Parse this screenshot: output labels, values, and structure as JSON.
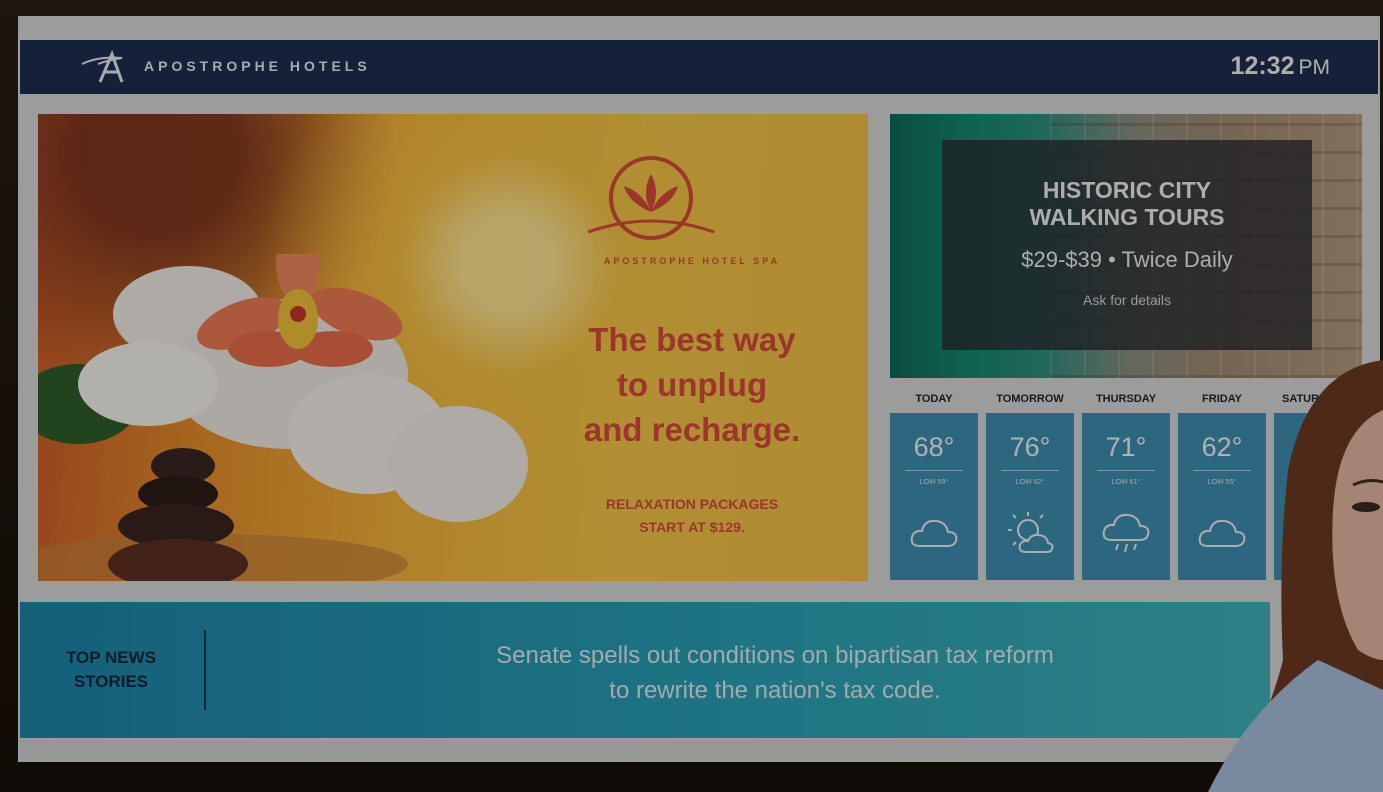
{
  "header": {
    "brand": "APOSTROPHE HOTELS",
    "time": "12:32",
    "ampm": "PM",
    "logo_icon": "apostrophe-a-logo-icon"
  },
  "spa_ad": {
    "spa_name": "APOSTROPHE HOTEL SPA",
    "headline": "The best way\nto unplug\nand recharge.",
    "offer": "RELAXATION PACKAGES\nSTART AT $129.",
    "emblem_icon": "lotus-icon",
    "accent_color": "#d94a3b"
  },
  "tours_ad": {
    "title": "HISTORIC CITY\nWALKING TOURS",
    "price": "$29-$39 • Twice Daily",
    "note": "Ask for details"
  },
  "weather": {
    "days": [
      {
        "label": "TODAY",
        "high": "68°",
        "low": "LOW 59°",
        "icon": "cloudy-icon"
      },
      {
        "label": "TOMORROW",
        "high": "76°",
        "low": "LOW 62°",
        "icon": "partly-sunny-icon"
      },
      {
        "label": "THURSDAY",
        "high": "71°",
        "low": "LOW 61°",
        "icon": "rain-cloud-icon"
      },
      {
        "label": "FRIDAY",
        "high": "62°",
        "low": "LOW 55°",
        "icon": "cloudy-icon"
      },
      {
        "label": "SATUR",
        "high": "",
        "low": "",
        "icon": ""
      }
    ],
    "card_color": "#3f8fb0"
  },
  "news": {
    "label": "TOP NEWS\nSTORIES",
    "headline": "Senate spells out conditions on bipartisan tax reform\nto rewrite the nation's tax code."
  }
}
